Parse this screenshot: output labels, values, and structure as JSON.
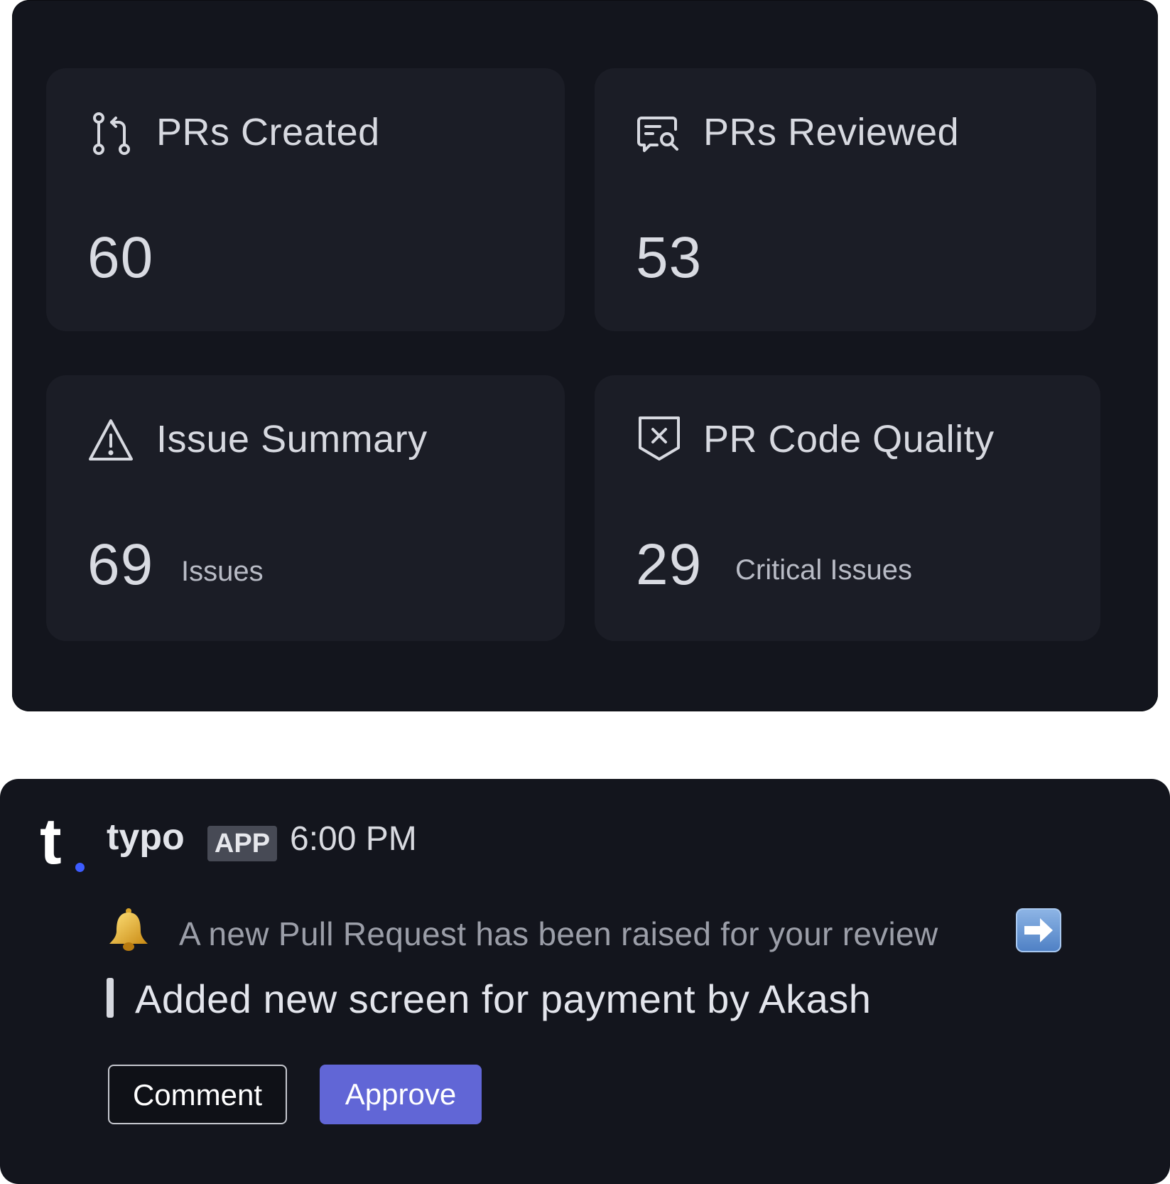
{
  "dashboard": {
    "cards": [
      {
        "title": "PRs Created",
        "icon": "git-pull-request-icon",
        "value": "60",
        "unit": ""
      },
      {
        "title": "PRs Reviewed",
        "icon": "review-message-search-icon",
        "value": "53",
        "unit": ""
      },
      {
        "title": "Issue Summary",
        "icon": "warning-triangle-icon",
        "value": "69",
        "unit": "Issues"
      },
      {
        "title": "PR Code Quality",
        "icon": "shield-x-icon",
        "value": "29",
        "unit": "Critical Issues"
      }
    ]
  },
  "notification": {
    "logo": "t",
    "app_name": "typo",
    "badge": "APP",
    "time": "6:00 PM",
    "bell_icon": "bell-icon",
    "message": "A new Pull Request has been raised for your review",
    "arrow_icon": "right-arrow-icon",
    "pr_title": "Added new screen for payment by Akash",
    "buttons": {
      "comment": "Comment",
      "approve": "Approve"
    },
    "colors": {
      "approve": "#6166d6",
      "logo_dot": "#3d5cff"
    }
  }
}
